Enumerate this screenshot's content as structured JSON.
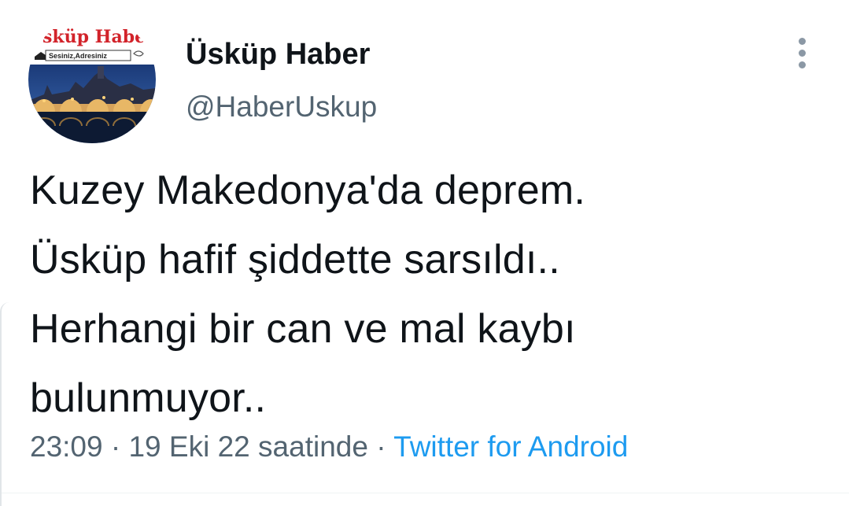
{
  "author": {
    "display_name": "Üsküp Haber",
    "handle": "@HaberUskup",
    "avatar_logo_text": "sküp Habe",
    "avatar_tagline": "Sesiniz,Adresiniz"
  },
  "tweet": {
    "lines": [
      "Kuzey Makedonya'da deprem.",
      "Üsküp hafif şiddette sarsıldı..",
      "Herhangi bir can ve mal kaybı",
      "bulunmuyor.."
    ]
  },
  "meta": {
    "time": "23:09",
    "separator": "·",
    "date": "19 Eki 22 saatinde",
    "source": "Twitter for Android"
  },
  "icons": {
    "more": "more-vertical-icon"
  },
  "colors": {
    "text": "#0f1419",
    "secondary": "#536471",
    "link": "#1d9bf0",
    "logo_red": "#d2232a"
  }
}
